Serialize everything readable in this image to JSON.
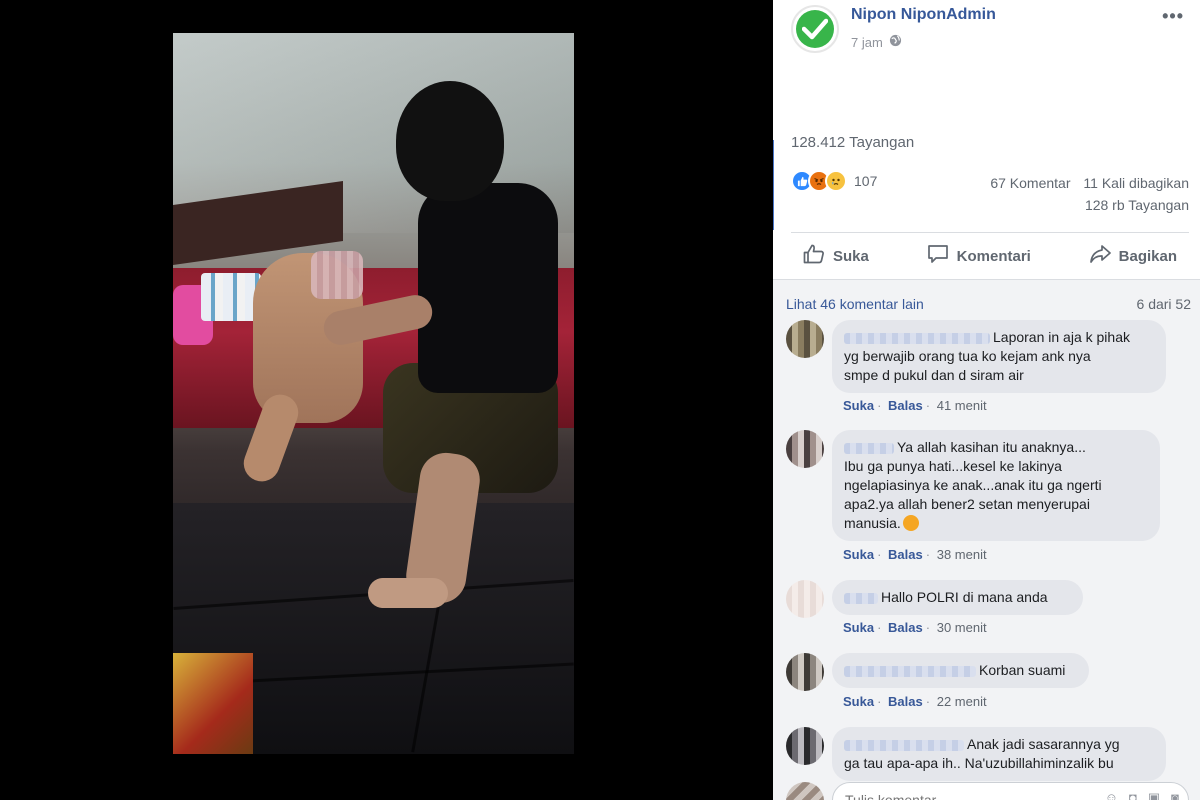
{
  "post": {
    "page_name": "Nipon NiponAdmin",
    "time": "7 jam",
    "privacy_icon": "globe-icon",
    "views": "128.412 Tayangan",
    "reaction_icons": [
      "like-icon",
      "angry-icon",
      "sad-icon"
    ],
    "reaction_count": "107",
    "comments_count": "67 Komentar",
    "shares_count": "11 Kali dibagikan",
    "views_short": "128 rb Tayangan"
  },
  "actions": {
    "like": "Suka",
    "comment": "Komentari",
    "share": "Bagikan"
  },
  "comments_header": {
    "more": "Lihat 46 komentar lain",
    "count": "6 dari 52"
  },
  "comments": [
    {
      "lines": [
        "Laporan in aja k pihak",
        "yg berwajib orang tua ko kejam ank nya",
        "smpe d pukul dan d siram air"
      ],
      "like": "Suka",
      "reply": "Balas",
      "time": "41 menit"
    },
    {
      "lines": [
        "Ya allah kasihan itu anaknya...",
        "Ibu ga punya hati...kesel ke lakinya",
        "ngelapiasinya ke anak...anak itu ga ngerti",
        "apa2.ya allah bener2 setan menyerupai",
        "manusia."
      ],
      "like": "Suka",
      "reply": "Balas",
      "time": "38 menit"
    },
    {
      "lines": [
        "Hallo POLRI di mana anda"
      ],
      "like": "Suka",
      "reply": "Balas",
      "time": "30 menit"
    },
    {
      "lines": [
        "Korban suami"
      ],
      "like": "Suka",
      "reply": "Balas",
      "time": "22 menit"
    },
    {
      "lines": [
        "Anak jadi sasarannya yg",
        "ga tau apa-apa ih.. Na'uzubillahiminzalik bu"
      ]
    }
  ],
  "composer": {
    "placeholder": "Tulis komentar..."
  },
  "colors": {
    "link": "#385898",
    "page_name": "#365899",
    "muted": "#606770",
    "bubble": "#e4e6eb",
    "verified_green": "#38b54a"
  }
}
